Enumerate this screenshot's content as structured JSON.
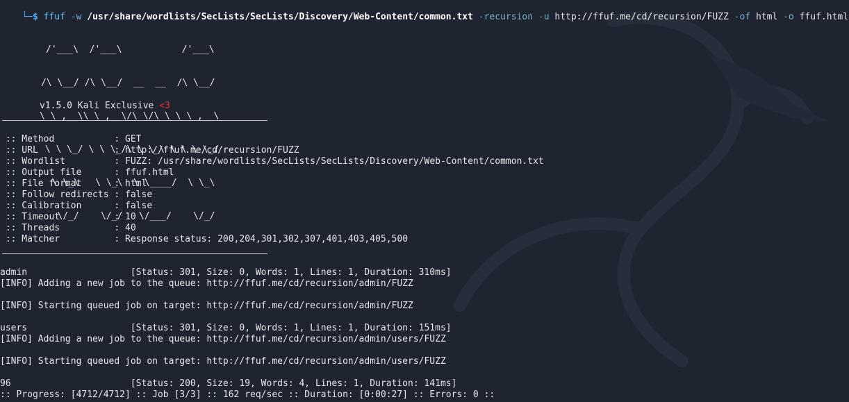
{
  "prompt": {
    "arrow": "└─",
    "dollar": "$",
    "command": "ffuf",
    "parts": [
      {
        "text": "-w",
        "style": "flag"
      },
      {
        "text": "/usr/share/wordlists/SecLists/SecLists/Discovery/Web-Content/common.txt",
        "style": "bold"
      },
      {
        "text": "-recursion",
        "style": "flag"
      },
      {
        "text": "-u",
        "style": "flag"
      },
      {
        "text": "http://ffuf.me/cd/recursion/FUZZ",
        "style": "arg"
      },
      {
        "text": "-of",
        "style": "flag"
      },
      {
        "text": "html",
        "style": "arg"
      },
      {
        "text": "-o",
        "style": "flag"
      },
      {
        "text": "ffuf.html",
        "style": "arg"
      }
    ]
  },
  "banner": {
    "logo_lines": [
      "/'___\\  /'___\\           /'___\\",
      "/\\ \\__/ /\\ \\__/  __  __  /\\ \\__/",
      "\\ \\ ,__\\\\ \\ ,__\\/\\ \\/\\ \\ \\ \\ ,__\\",
      " \\ \\ \\_/ \\ \\ \\_/\\ \\ \\_\\ \\ \\ \\ \\_/",
      "  \\ \\_\\   \\ \\_\\  \\ \\____/  \\ \\_\\",
      "   \\/_/    \\/_/   \\/___/    \\/_/"
    ],
    "version": "v1.5.0 Kali Exclusive ",
    "heart": "<3"
  },
  "config": [
    {
      "key": " :: Method           ",
      "value": ": GET"
    },
    {
      "key": " :: URL              ",
      "value": ": http://ffuf.me/cd/recursion/FUZZ"
    },
    {
      "key": " :: Wordlist         ",
      "value": ": FUZZ: /usr/share/wordlists/SecLists/SecLists/Discovery/Web-Content/common.txt"
    },
    {
      "key": " :: Output file      ",
      "value": ": ffuf.html"
    },
    {
      "key": " :: File format      ",
      "value": ": html"
    },
    {
      "key": " :: Follow redirects ",
      "value": ": false"
    },
    {
      "key": " :: Calibration      ",
      "value": ": false"
    },
    {
      "key": " :: Timeout          ",
      "value": ": 10"
    },
    {
      "key": " :: Threads          ",
      "value": ": 40"
    },
    {
      "key": " :: Matcher          ",
      "value": ": Response status: 200,204,301,302,307,401,403,405,500"
    }
  ],
  "results": [
    {
      "text": "admin                   [Status: 301, Size: 0, Words: 1, Lines: 1, Duration: 310ms]"
    },
    {
      "text": "[INFO] Adding a new job to the queue: http://ffuf.me/cd/recursion/admin/FUZZ"
    },
    {
      "text": ""
    },
    {
      "text": "[INFO] Starting queued job on target: http://ffuf.me/cd/recursion/admin/FUZZ"
    },
    {
      "text": ""
    },
    {
      "text": "users                   [Status: 301, Size: 0, Words: 1, Lines: 1, Duration: 151ms]"
    },
    {
      "text": "[INFO] Adding a new job to the queue: http://ffuf.me/cd/recursion/admin/users/FUZZ"
    },
    {
      "text": ""
    },
    {
      "text": "[INFO] Starting queued job on target: http://ffuf.me/cd/recursion/admin/users/FUZZ"
    },
    {
      "text": ""
    },
    {
      "text": "96                      [Status: 200, Size: 19, Words: 4, Lines: 1, Duration: 141ms]"
    }
  ],
  "progress_line": ":: Progress: [4712/4712] :: Job [3/3] :: 162 req/sec :: Duration: [0:00:27] :: Errors: 0 ::",
  "colors": {
    "background": "#1e2430",
    "text": "#e6e8ec",
    "prompt": "#4fb0ff",
    "heart": "#e0303a"
  },
  "icons": {
    "background": "kali-dragon-icon"
  }
}
